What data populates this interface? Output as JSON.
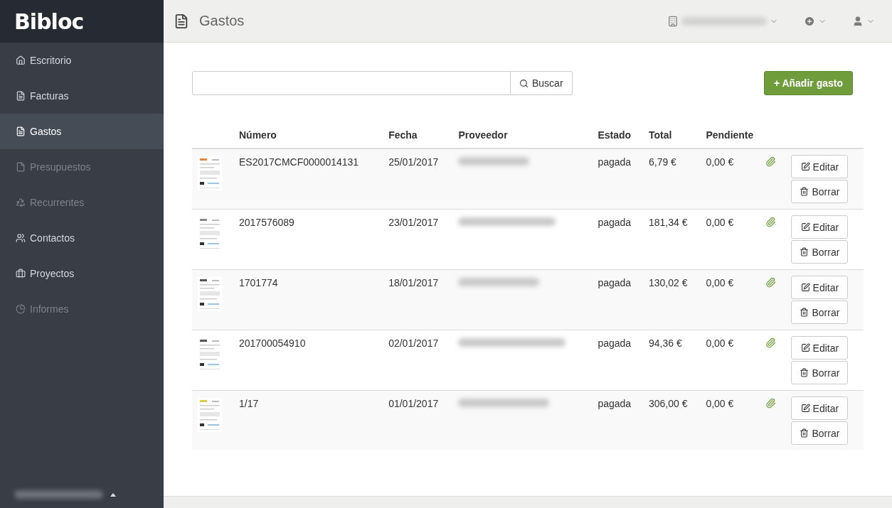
{
  "brand": "Bibloc",
  "sidebar": {
    "items": [
      {
        "label": "Escritorio",
        "kind": "home",
        "selected": false,
        "disabled": false
      },
      {
        "label": "Facturas",
        "kind": "invoice",
        "selected": false,
        "disabled": false
      },
      {
        "label": "Gastos",
        "kind": "expense",
        "selected": true,
        "disabled": false
      },
      {
        "label": "Presupuestos",
        "kind": "quote",
        "selected": false,
        "disabled": true
      },
      {
        "label": "Recurrentes",
        "kind": "recurring",
        "selected": false,
        "disabled": true
      },
      {
        "label": "Contactos",
        "kind": "contacts",
        "selected": false,
        "disabled": false
      },
      {
        "label": "Proyectos",
        "kind": "projects",
        "selected": false,
        "disabled": false
      },
      {
        "label": "Informes",
        "kind": "reports",
        "selected": false,
        "disabled": true
      }
    ]
  },
  "header": {
    "title": "Gastos"
  },
  "search": {
    "button": "Buscar"
  },
  "add_button": "+ Añadir gasto",
  "table": {
    "columns": [
      "Número",
      "Fecha",
      "Proveedor",
      "Estado",
      "Total",
      "Pendiente"
    ],
    "rows": [
      {
        "number": "ES2017CMCF0000014131",
        "date": "25/01/2017",
        "status": "pagada",
        "total": "6,79 €",
        "pending": "0,00 €",
        "attachment": true,
        "edit": "Editar",
        "delete": "Borrar"
      },
      {
        "number": "2017576089",
        "date": "23/01/2017",
        "status": "pagada",
        "total": "181,34 €",
        "pending": "0,00 €",
        "attachment": true,
        "edit": "Editar",
        "delete": "Borrar"
      },
      {
        "number": "1701774",
        "date": "18/01/2017",
        "status": "pagada",
        "total": "130,02 €",
        "pending": "0,00 €",
        "attachment": true,
        "edit": "Editar",
        "delete": "Borrar"
      },
      {
        "number": "201700054910",
        "date": "02/01/2017",
        "status": "pagada",
        "total": "94,36 €",
        "pending": "0,00 €",
        "attachment": true,
        "edit": "Editar",
        "delete": "Borrar"
      },
      {
        "number": "1/17",
        "date": "01/01/2017",
        "status": "pagada",
        "total": "306,00 €",
        "pending": "0,00 €",
        "attachment": true,
        "edit": "Editar",
        "delete": "Borrar"
      }
    ]
  }
}
